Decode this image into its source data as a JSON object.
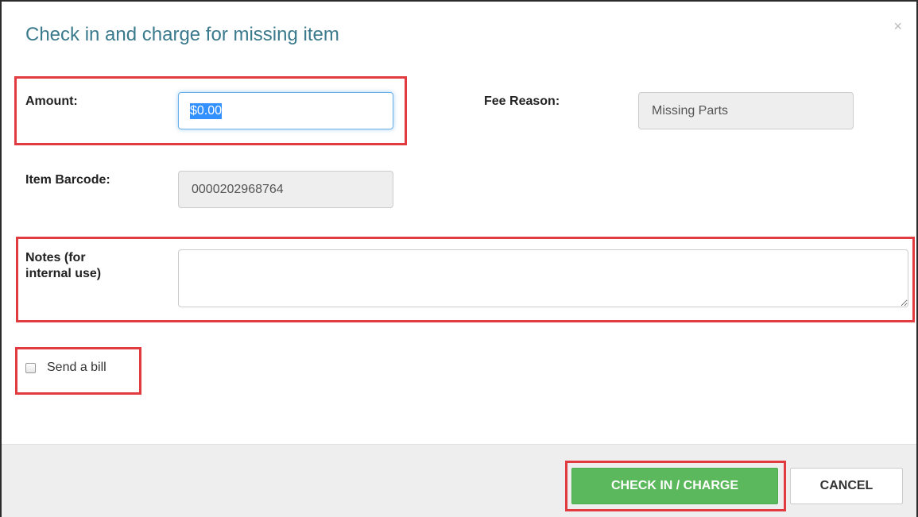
{
  "dialog": {
    "title": "Check in and charge for missing item",
    "close_symbol": "×"
  },
  "form": {
    "amount": {
      "label": "Amount:",
      "value": "$0.00"
    },
    "fee_reason": {
      "label": "Fee Reason:",
      "value": "Missing Parts"
    },
    "item_barcode": {
      "label": "Item Barcode:",
      "value": "0000202968764"
    },
    "notes": {
      "label_line1": "Notes (for",
      "label_line2": "internal use)",
      "value": ""
    },
    "send_bill": {
      "label": "Send a bill",
      "checked": false
    }
  },
  "footer": {
    "primary_button": "CHECK IN / CHARGE",
    "cancel_button": "CANCEL"
  },
  "colors": {
    "title": "#3a7a8c",
    "highlight": "#e23b3f",
    "primary": "#5cb85c",
    "selection": "#3390ff"
  }
}
